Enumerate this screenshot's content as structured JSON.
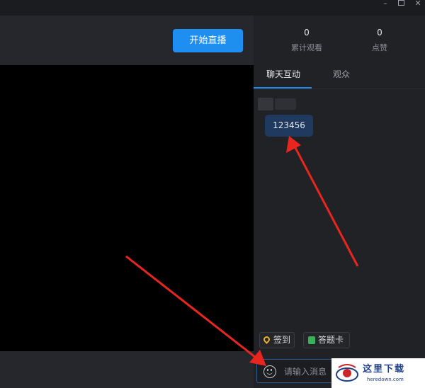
{
  "window": {
    "controls": {
      "minimize_icon": "minimize-icon",
      "maximize_icon": "maximize-icon",
      "close_icon": "close-icon"
    }
  },
  "toolbar": {
    "start_live_label": "开始直播"
  },
  "stats": {
    "cumulative_views": {
      "value": "0",
      "label": "累计观看"
    },
    "likes": {
      "value": "0",
      "label": "点赞"
    }
  },
  "tabs": [
    {
      "label": "聊天互动",
      "active": true
    },
    {
      "label": "观众",
      "active": false
    }
  ],
  "chat": {
    "messages": [
      {
        "text": "123456"
      }
    ]
  },
  "actions": {
    "sign_in_label": "签到",
    "answer_card_label": "答题卡"
  },
  "composer": {
    "placeholder": "请输入消息",
    "emoji_icon": "smiley-icon"
  },
  "colors": {
    "accent": "#1e8ef1",
    "bubble": "#1f3a5e",
    "annotation": "#e8251f"
  },
  "watermark": {
    "text": "这里下载",
    "url": "heredown.com"
  }
}
